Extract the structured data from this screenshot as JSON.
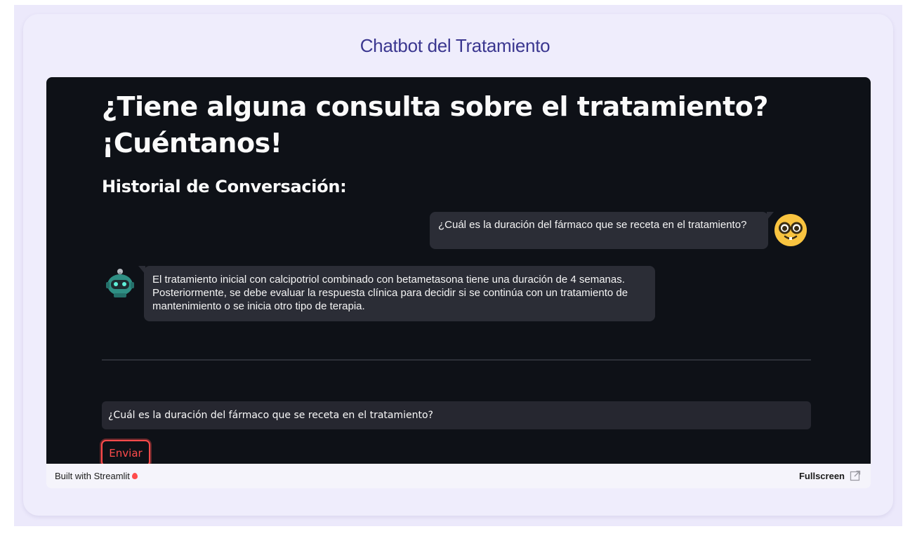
{
  "page": {
    "title": "Chatbot del Tratamiento"
  },
  "app": {
    "heading": "¿Tiene alguna consulta sobre el tratamiento? ¡Cuéntanos!",
    "history_heading": "Historial de Conversación:",
    "messages": [
      {
        "role": "user",
        "avatar_icon": "nerd-face-icon",
        "text": "¿Cuál es la duración del fármaco que se receta en el tratamiento?"
      },
      {
        "role": "bot",
        "avatar_icon": "robot-icon",
        "text": "El tratamiento inicial con calcipotriol combinado con betametasona tiene una duración de 4 semanas. Posteriormente, se debe evaluar la respuesta clínica para decidir si se continúa con un tratamiento de mantenimiento o se inicia otro tipo de terapia."
      }
    ],
    "input": {
      "value": "¿Cuál es la duración del fármaco que se receta en el tratamiento?"
    },
    "send_label": "Enviar"
  },
  "footer": {
    "built_with": "Built with Streamlit",
    "balloon_icon": "balloon-icon",
    "fullscreen_label": "Fullscreen",
    "fullscreen_icon": "external-link-icon"
  },
  "colors": {
    "title": "#3b3790",
    "app_background": "#0e1117",
    "bubble": "#2b2d36",
    "accent": "#ff4b4b",
    "card_background": "#efedfc"
  }
}
